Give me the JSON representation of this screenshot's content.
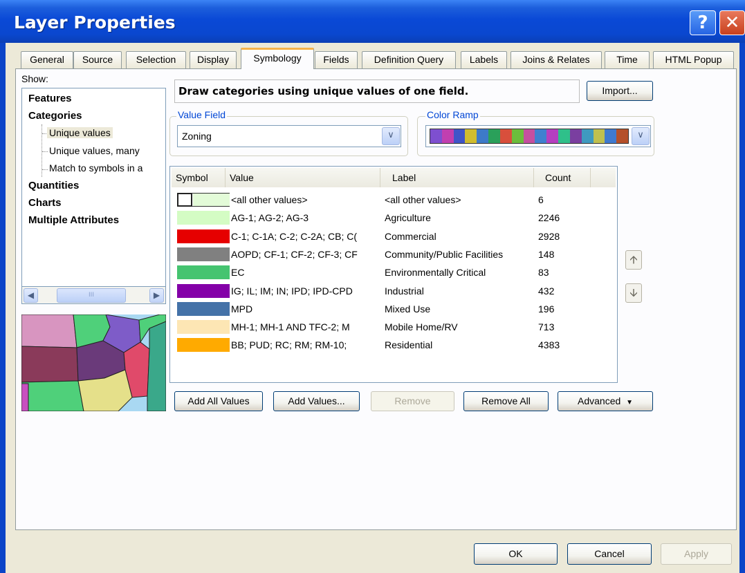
{
  "window": {
    "title": "Layer Properties",
    "help_icon": "?",
    "close_icon": "✕"
  },
  "tabs": [
    "General",
    "Source",
    "Selection",
    "Display",
    "Symbology",
    "Fields",
    "Definition Query",
    "Labels",
    "Joins & Relates",
    "Time",
    "HTML Popup"
  ],
  "active_tab": "Symbology",
  "show": {
    "label": "Show:",
    "tree": [
      "Features",
      "Categories",
      "Unique values",
      "Unique values, many",
      "Match to symbols in a",
      "Quantities",
      "Charts",
      "Multiple Attributes"
    ],
    "scroll_thumb": "III"
  },
  "description": "Draw categories using unique values of one field.",
  "import_button": "Import...",
  "value_field": {
    "label": "Value Field",
    "value": "Zoning"
  },
  "color_ramp": {
    "label": "Color Ramp",
    "colors": [
      "#7e4fd0",
      "#c13fb0",
      "#3f55c8",
      "#d0bd2e",
      "#3d7ac8",
      "#2aa05a",
      "#d84f3c",
      "#6bbd3c",
      "#c54fa0",
      "#3f80d0",
      "#b53fc0",
      "#2fc08a",
      "#7a3fa0",
      "#3f9ac0",
      "#c0c04f",
      "#3f7ad0",
      "#b5502a"
    ]
  },
  "table": {
    "headers": [
      "Symbol",
      "Value",
      "Label",
      "Count"
    ],
    "rows": [
      {
        "color": "#ffffff",
        "value": "<all other values>",
        "label": "<all other values>",
        "count": "6"
      },
      {
        "color": "#d4fcc4",
        "value": "AG-1; AG-2; AG-3",
        "label": "Agriculture",
        "count": "2246"
      },
      {
        "color": "#e60000",
        "value": "C-1; C-1A; C-2; C-2A; CB; C(",
        "label": "Commercial",
        "count": "2928"
      },
      {
        "color": "#808080",
        "value": "AOPD; CF-1; CF-2; CF-3; CF",
        "label": "Community/Public Facilities",
        "count": "148"
      },
      {
        "color": "#45c470",
        "value": "EC",
        "label": "Environmentally Critical",
        "count": "83"
      },
      {
        "color": "#8400a8",
        "value": "IG; IL; IM; IN; IPD; IPD-CPD",
        "label": "Industrial",
        "count": "432"
      },
      {
        "color": "#4472a8",
        "value": "MPD",
        "label": "Mixed Use",
        "count": "196"
      },
      {
        "color": "#fde6b4",
        "value": "MH-1; MH-1 AND TFC-2; M",
        "label": "Mobile Home/RV",
        "count": "713"
      },
      {
        "color": "#ffaa00",
        "value": "BB; PUD; RC; RM; RM-10;",
        "label": "Residential",
        "count": "4383"
      }
    ]
  },
  "buttons": {
    "add_all": "Add All Values",
    "add": "Add Values...",
    "remove": "Remove",
    "remove_all": "Remove All",
    "advanced": "Advanced",
    "ok": "OK",
    "cancel": "Cancel",
    "apply": "Apply"
  },
  "icons": {
    "dropdown": "chevron-down-icon",
    "up": "arrow-up-icon",
    "down": "arrow-down-icon"
  }
}
